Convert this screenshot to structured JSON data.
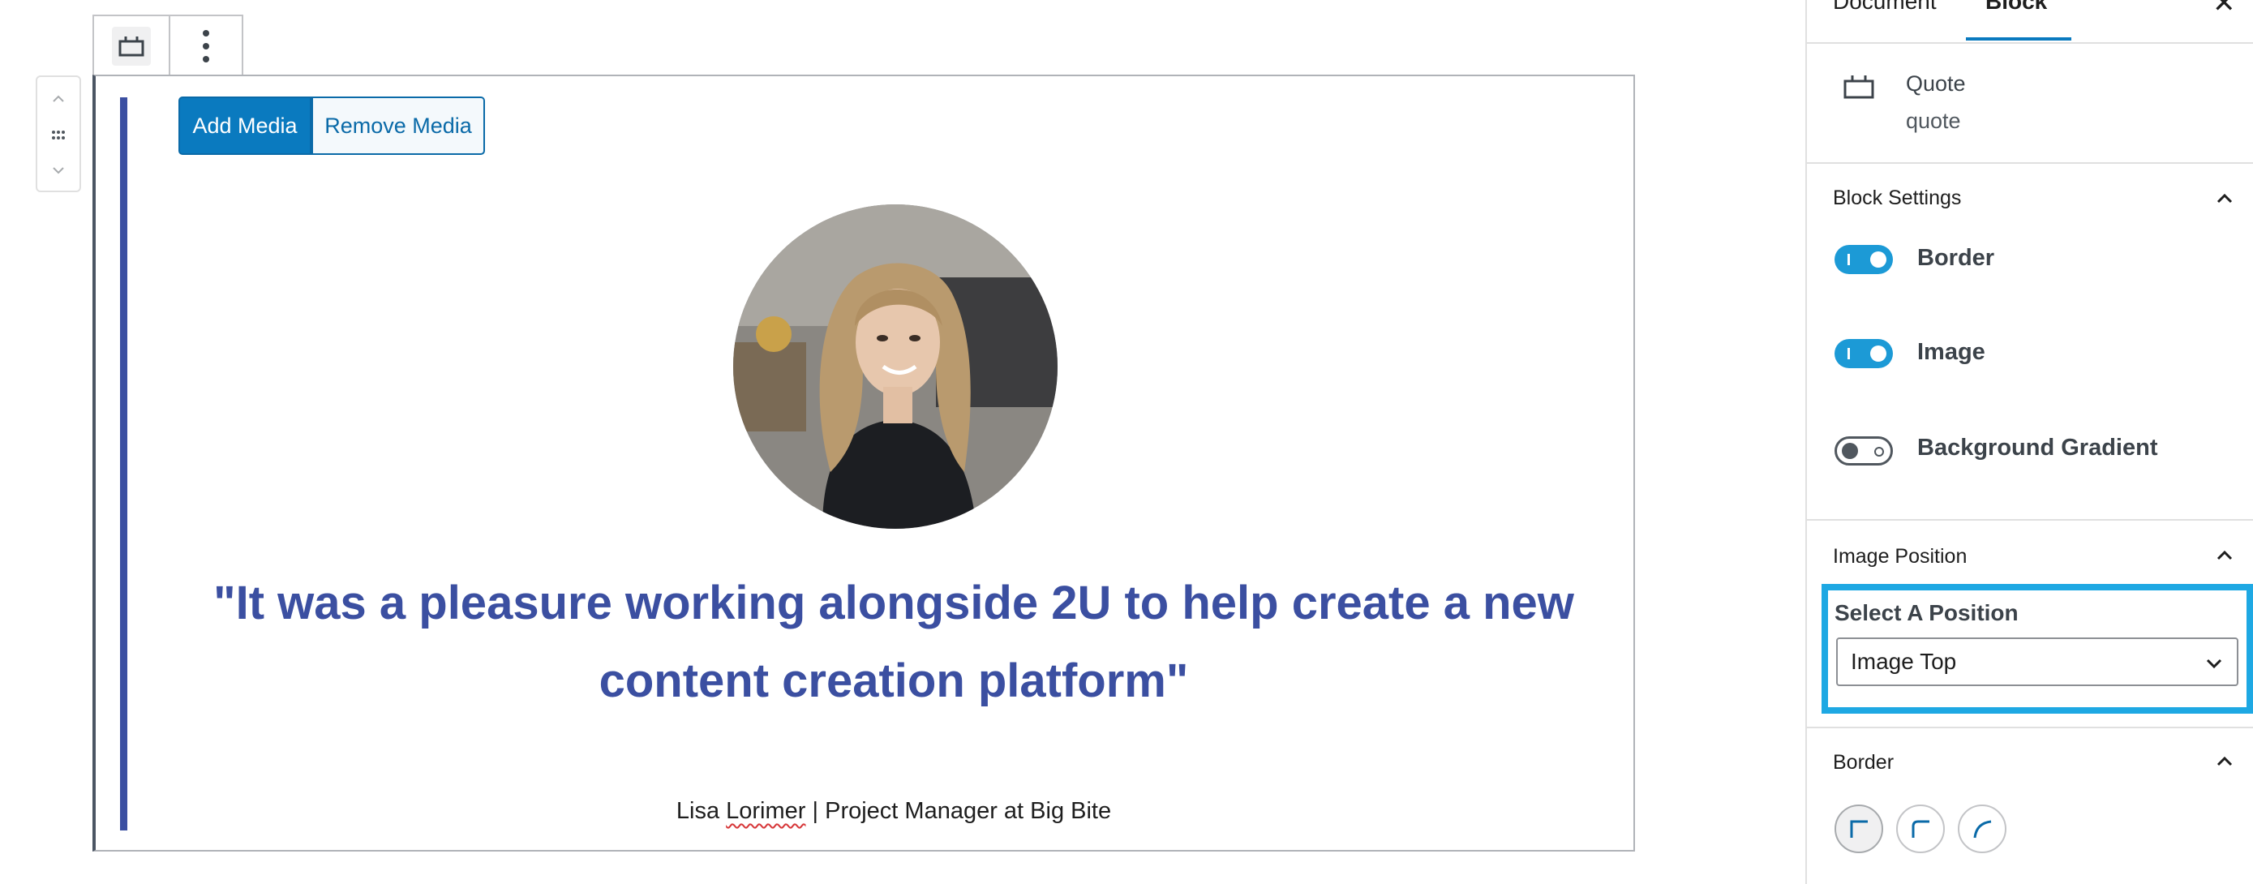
{
  "editor": {
    "media_buttons": {
      "add": "Add Media",
      "remove": "Remove Media"
    },
    "quote_text": "\"It was a pleasure working alongside 2U to help create a new content creation platform\"",
    "citation": {
      "name_first": "Lisa ",
      "name_last": "Lorimer",
      "role": " | Project Manager at Big Bite"
    },
    "colors": {
      "quote": "#3b4fa1",
      "primary_button": "#0a7abf"
    }
  },
  "sidebar": {
    "tabs": [
      {
        "label": "Document"
      },
      {
        "label": "Block"
      }
    ],
    "block_card": {
      "title": "Quote",
      "subtitle": "quote"
    },
    "block_settings": {
      "heading": "Block Settings",
      "toggles": [
        {
          "label": "Border",
          "state": "on"
        },
        {
          "label": "Image",
          "state": "on"
        },
        {
          "label": "Background Gradient",
          "state": "off"
        }
      ]
    },
    "image_position": {
      "heading": "Image Position",
      "select_label": "Select A Position",
      "selected": "Image Top"
    },
    "border": {
      "heading": "Border",
      "corner_styles": [
        "square-corner-icon",
        "rounded-corner-icon",
        "curved-corner-icon"
      ]
    },
    "accent_color": "#1c9ad6",
    "highlight_color": "#1ea8e3"
  }
}
